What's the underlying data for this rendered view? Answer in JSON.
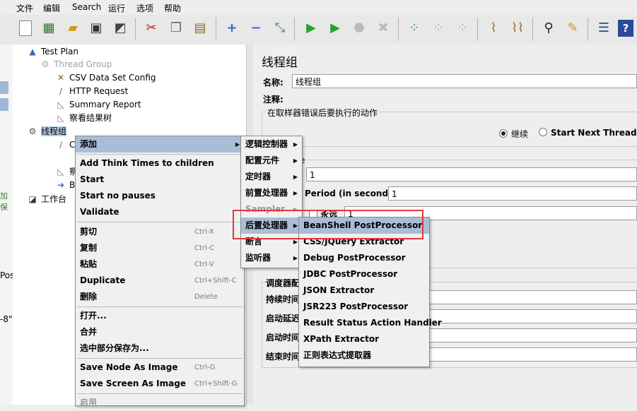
{
  "menubar": {
    "file": "文件",
    "edit": "编辑",
    "search": "Search",
    "run": "运行",
    "options": "选项",
    "help": "帮助"
  },
  "toolbar": {
    "icons": [
      "new-icon",
      "templates-icon",
      "open-icon",
      "save-icon",
      "save-as-icon",
      "cut-icon",
      "copy-icon",
      "paste-icon",
      "expand-icon",
      "collapse-icon",
      "toggle-icon",
      "start-icon",
      "start-no-pause-icon",
      "stop-icon",
      "shutdown-icon",
      "remote-start-icon",
      "remote-stop-icon",
      "remote-shutdown-icon",
      "clear-icon",
      "clear-all-icon",
      "search-icon",
      "reset-search-icon",
      "function-helper-icon",
      "help-icon"
    ]
  },
  "tree": {
    "test_plan": "Test Plan",
    "thread_group_disabled": "Thread Group",
    "csv": "CSV Data Set Config",
    "http": "HTTP Request",
    "summary": "Summary Report",
    "result_tree": "察看结果树",
    "thread_group": "线程组",
    "child_c": "C",
    "child_cha": "察",
    "child_b": "B",
    "workbench": "工作台"
  },
  "gutter": {
    "fragment1": "加保",
    "fragment2": "Pos",
    "fragment3": "-8\""
  },
  "panel": {
    "title": "线程组",
    "name_label": "名称:",
    "name_value": "线程组",
    "comment_label": "注释:",
    "error_group": "在取样器错误后要执行的动作",
    "continue_label": "继续",
    "next_loop_label": "Start Next Thread Loop",
    "props_fragment": "e",
    "threads_value": "1",
    "ramp_label": "Period (in seconds):",
    "ramp_value": "1",
    "forever_label": "永远",
    "loop_value": "1",
    "scheduler_group": "调度器配",
    "duration_label": "持续时间",
    "delay_label": "启动延迟",
    "start_label": "启动时间",
    "end_label": "结束时间"
  },
  "context_menu": {
    "add": "添加",
    "think_times": "Add Think Times to children",
    "start": "Start",
    "start_no_pauses": "Start no pauses",
    "validate": "Validate",
    "cut": "剪切",
    "cut_acc": "Ctrl-X",
    "copy": "复制",
    "copy_acc": "Ctrl-C",
    "paste": "粘贴",
    "paste_acc": "Ctrl-V",
    "duplicate": "Duplicate",
    "duplicate_acc": "Ctrl+Shift-C",
    "delete": "删除",
    "delete_acc": "Delete",
    "open": "打开...",
    "merge": "合并",
    "save_selection": "选中部分保存为...",
    "save_node_image": "Save Node As Image",
    "save_node_image_acc": "Ctrl-G",
    "save_screen_image": "Save Screen As Image",
    "save_screen_image_acc": "Ctrl+Shift-G",
    "enable": "启用"
  },
  "add_submenu": {
    "logic": "逻辑控制器",
    "config": "配置元件",
    "timer": "定时器",
    "pre": "前置处理器",
    "sampler": "Sampler",
    "post": "后置处理器",
    "assert": "断言",
    "listener": "监听器"
  },
  "post_submenu": {
    "items": [
      "BeanShell PostProcessor",
      "CSS/JQuery Extractor",
      "Debug PostProcessor",
      "JDBC PostProcessor",
      "JSON Extractor",
      "JSR223 PostProcessor",
      "Result Status Action Handler",
      "XPath Extractor",
      "正则表达式提取器"
    ]
  },
  "colors": {
    "highlight": "#a9bdd6",
    "callout": "#e0393c",
    "selection": "#b8cfe5"
  }
}
